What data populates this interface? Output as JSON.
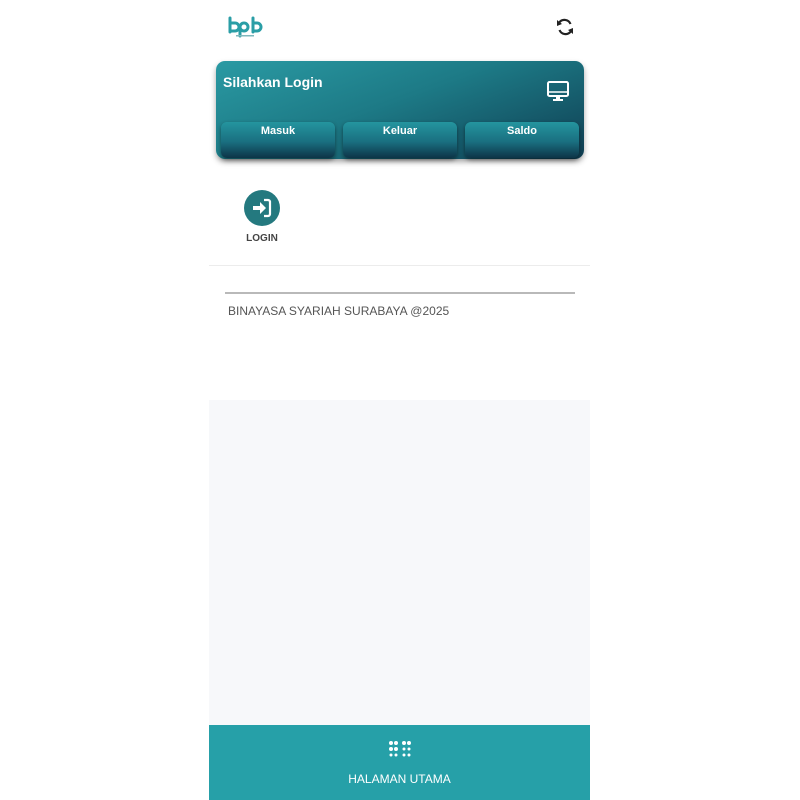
{
  "header": {
    "logo_icon": "bpb-logo-icon",
    "refresh_icon": "refresh-icon"
  },
  "card": {
    "title": "Silahkan Login",
    "icon": "monitor-icon",
    "buttons": [
      "Masuk",
      "Keluar",
      "Saldo"
    ]
  },
  "menu": {
    "login": {
      "label": "LOGIN",
      "icon": "sign-in-icon"
    }
  },
  "footer": {
    "text": "BINAYASA SYARIAH SURABAYA @2025"
  },
  "bottom_nav": {
    "label": "HALAMAN UTAMA",
    "icon": "grid-dots-icon"
  },
  "colors": {
    "accent": "#26a0a8",
    "card_dark": "#0f3e52",
    "icon_teal": "#24797f"
  }
}
